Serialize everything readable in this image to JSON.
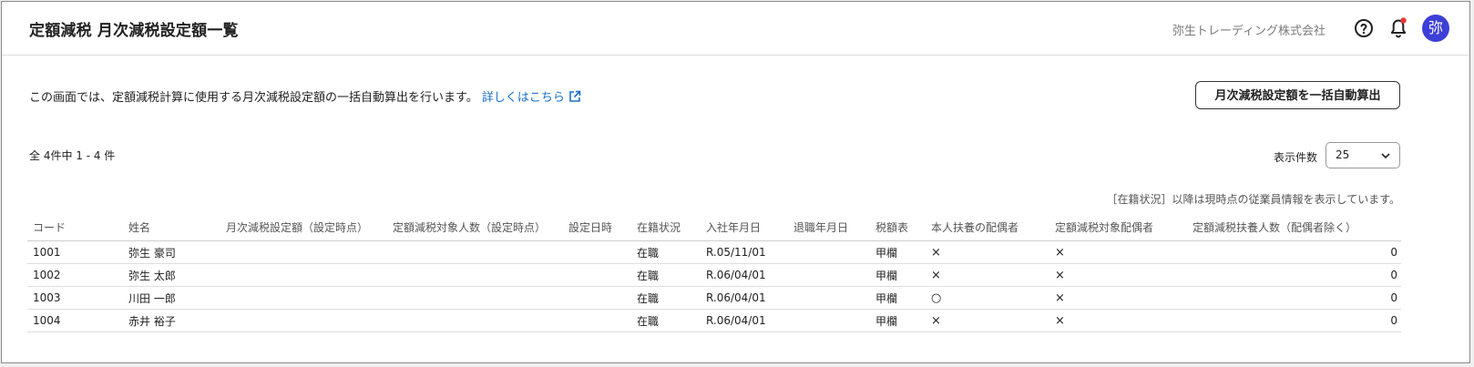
{
  "header": {
    "title": "定額減税 月次減税設定額一覧",
    "company": "弥生トレーディング株式会社",
    "avatar_initial": "弥",
    "accent_color": "#3d3fd6",
    "notification_dot_color": "#e53935"
  },
  "intro": {
    "description": "この画面では、定額減税計算に使用する月次減税設定額の一括自動算出を行います。",
    "link_label": "詳しくはこちら",
    "bulk_button_label": "月次減税設定額を一括自動算出"
  },
  "list": {
    "count_text": "全 4件中 1 - 4 件",
    "per_page_label": "表示件数",
    "per_page_value": "25",
    "note": "［在籍状況］以降は現時点の従業員情報を表示しています。"
  },
  "table": {
    "headers": {
      "code": "コード",
      "name": "姓名",
      "monthly_amount": "月次減税設定額（設定時点）",
      "target_count": "定額減税対象人数（設定時点）",
      "set_date": "設定日時",
      "status": "在籍状況",
      "join_date": "入社年月日",
      "leave_date": "退職年月日",
      "tax_table": "税額表",
      "self_spouse": "本人扶養の配偶者",
      "target_spouse": "定額減税対象配偶者",
      "dependents": "定額減税扶養人数（配偶者除く）"
    },
    "rows": [
      {
        "code": "1001",
        "name": "弥生 豪司",
        "monthly_amount": "",
        "target_count": "",
        "set_date": "",
        "status": "在職",
        "join_date": "R.05/11/01",
        "leave_date": "",
        "tax_table": "甲欄",
        "self_spouse": "×",
        "target_spouse": "×",
        "dependents": "0"
      },
      {
        "code": "1002",
        "name": "弥生 太郎",
        "monthly_amount": "",
        "target_count": "",
        "set_date": "",
        "status": "在職",
        "join_date": "R.06/04/01",
        "leave_date": "",
        "tax_table": "甲欄",
        "self_spouse": "×",
        "target_spouse": "×",
        "dependents": "0"
      },
      {
        "code": "1003",
        "name": "川田 一郎",
        "monthly_amount": "",
        "target_count": "",
        "set_date": "",
        "status": "在職",
        "join_date": "R.06/04/01",
        "leave_date": "",
        "tax_table": "甲欄",
        "self_spouse": "○",
        "target_spouse": "×",
        "dependents": "0"
      },
      {
        "code": "1004",
        "name": "赤井 裕子",
        "monthly_amount": "",
        "target_count": "",
        "set_date": "",
        "status": "在職",
        "join_date": "R.06/04/01",
        "leave_date": "",
        "tax_table": "甲欄",
        "self_spouse": "×",
        "target_spouse": "×",
        "dependents": "0"
      }
    ]
  }
}
